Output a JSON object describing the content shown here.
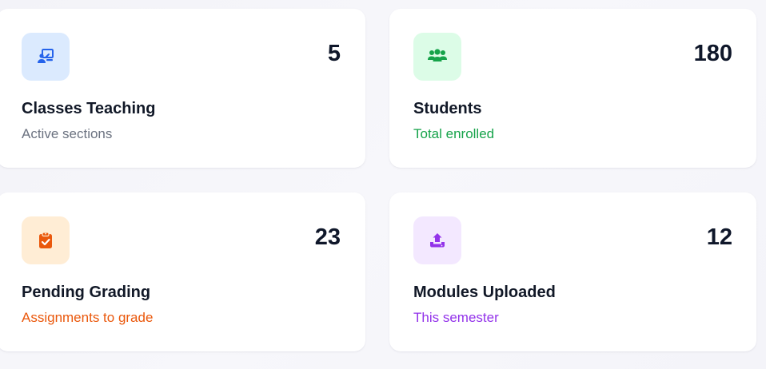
{
  "cards": [
    {
      "value": "5",
      "title": "Classes Teaching",
      "subtitle": "Active sections",
      "icon": "teacher-board-icon",
      "icon_bg": "#dbeafe",
      "icon_color": "#2563eb",
      "subtitle_color": "#6b7280"
    },
    {
      "value": "180",
      "title": "Students",
      "subtitle": "Total enrolled",
      "icon": "users-group-icon",
      "icon_bg": "#dcfce7",
      "icon_color": "#16a34a",
      "subtitle_color": "#16a34a"
    },
    {
      "value": "23",
      "title": "Pending Grading",
      "subtitle": "Assignments to grade",
      "icon": "clipboard-check-icon",
      "icon_bg": "#ffedd5",
      "icon_color": "#ea580c",
      "subtitle_color": "#ea580c"
    },
    {
      "value": "12",
      "title": "Modules Uploaded",
      "subtitle": "This semester",
      "icon": "upload-icon",
      "icon_bg": "#f3e8ff",
      "icon_color": "#9333ea",
      "subtitle_color": "#9333ea"
    }
  ]
}
